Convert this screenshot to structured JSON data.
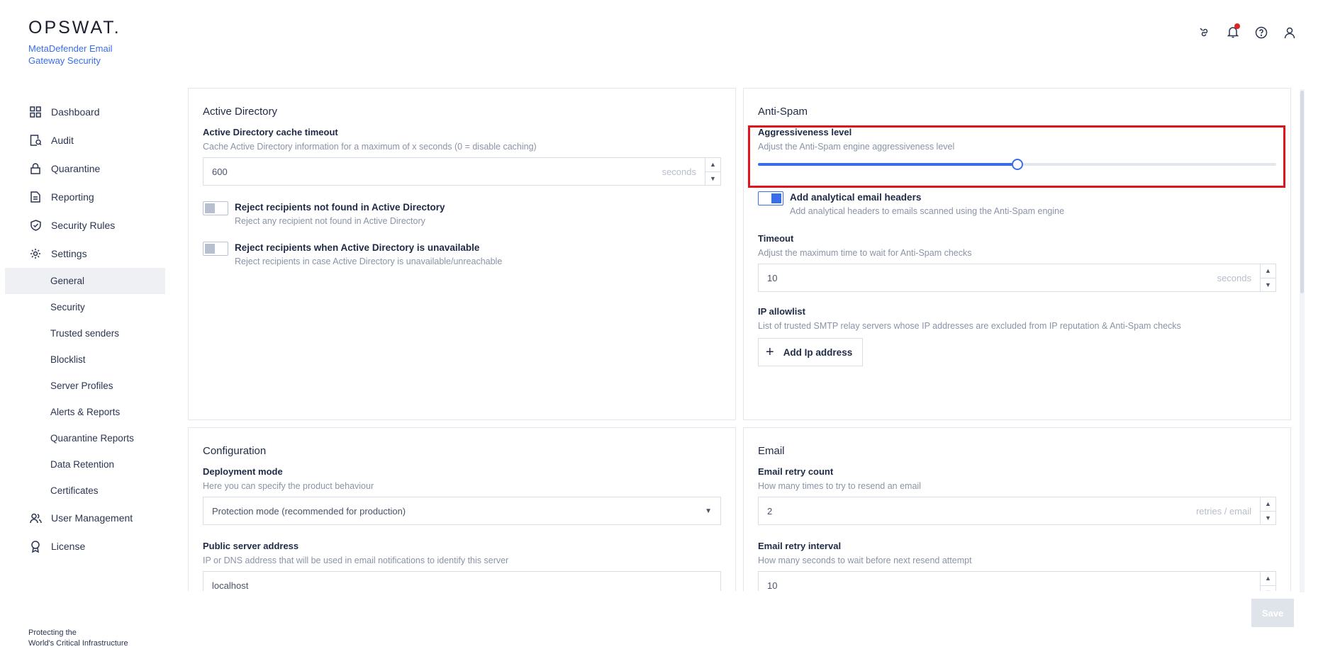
{
  "brand": {
    "logo": "OPSWAT.",
    "product": "MetaDefender Email Gateway Security",
    "tagline_line1": "Protecting the",
    "tagline_line2": "World's Critical Infrastructure"
  },
  "header_icons": [
    "link-icon",
    "bell-icon",
    "help-icon",
    "user-icon"
  ],
  "sidebar": {
    "items": [
      {
        "label": "Dashboard",
        "icon": "dashboard-icon"
      },
      {
        "label": "Audit",
        "icon": "audit-icon"
      },
      {
        "label": "Quarantine",
        "icon": "lock-icon"
      },
      {
        "label": "Reporting",
        "icon": "report-icon"
      },
      {
        "label": "Security Rules",
        "icon": "shield-icon"
      },
      {
        "label": "Settings",
        "icon": "gear-icon"
      }
    ],
    "settings_sub": [
      "General",
      "Security",
      "Trusted senders",
      "Blocklist",
      "Server Profiles",
      "Alerts & Reports",
      "Quarantine Reports",
      "Data Retention",
      "Certificates"
    ],
    "active_sub": "General",
    "bottom_items": [
      {
        "label": "User Management",
        "icon": "users-icon"
      },
      {
        "label": "License",
        "icon": "license-icon"
      }
    ]
  },
  "active_directory": {
    "title": "Active Directory",
    "cache_label": "Active Directory cache timeout",
    "cache_desc": "Cache Active Directory information for a maximum of x seconds (0 = disable caching)",
    "cache_value": "600",
    "cache_unit": "seconds",
    "reject_not_found_title": "Reject recipients not found in Active Directory",
    "reject_not_found_desc": "Reject any recipient not found in Active Directory",
    "reject_unavailable_title": "Reject recipients when Active Directory is unavailable",
    "reject_unavailable_desc": "Reject recipients in case Active Directory is unavailable/unreachable"
  },
  "anti_spam": {
    "title": "Anti-Spam",
    "aggr_label": "Aggressiveness level",
    "aggr_desc": "Adjust the Anti-Spam engine aggressiveness level",
    "aggr_level": 0.5,
    "headers_title": "Add analytical email headers",
    "headers_desc": "Add analytical headers to emails scanned using the Anti-Spam engine",
    "headers_enabled": true,
    "timeout_label": "Timeout",
    "timeout_desc": "Adjust the maximum time to wait for Anti-Spam checks",
    "timeout_value": "10",
    "timeout_unit": "seconds",
    "allowlist_label": "IP allowlist",
    "allowlist_desc": "List of trusted SMTP relay servers whose IP addresses are excluded from IP reputation & Anti-Spam checks",
    "add_ip_label": "Add Ip address"
  },
  "configuration": {
    "title": "Configuration",
    "deploy_label": "Deployment mode",
    "deploy_desc": "Here you can specify the product behaviour",
    "deploy_value": "Protection mode (recommended for production)",
    "server_label": "Public server address",
    "server_desc": "IP or DNS address that will be used in email notifications to identify this server",
    "server_value": "localhost"
  },
  "email": {
    "title": "Email",
    "retry_count_label": "Email retry count",
    "retry_count_desc": "How many times to try to resend an email",
    "retry_count_value": "2",
    "retry_count_unit": "retries / email",
    "retry_interval_label": "Email retry interval",
    "retry_interval_desc": "How many seconds to wait before next resend attempt",
    "retry_interval_value": "10"
  },
  "save_label": "Save",
  "colors": {
    "accent": "#3a6ee8",
    "highlight": "#e3131c",
    "notification": "#e02424"
  }
}
